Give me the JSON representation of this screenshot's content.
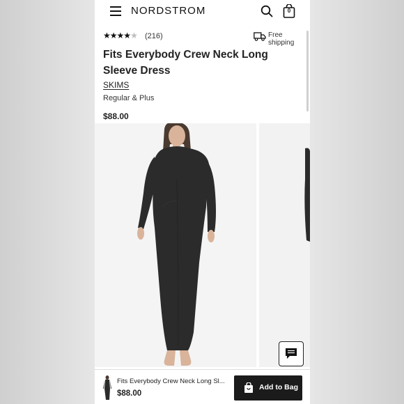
{
  "header": {
    "logo": "NORDSTROM",
    "bag_count": "0"
  },
  "product": {
    "rating": 4,
    "rating_max": 5,
    "review_count": "(216)",
    "shipping": "Free shipping",
    "title": "Fits Everybody Crew Neck Long Sleeve Dress",
    "brand": "SKIMS",
    "size_range": "Regular & Plus",
    "price": "$88.00"
  },
  "sticky_bar": {
    "name": "Fits Everybody Crew Neck Long Sl...",
    "price": "$88.00",
    "button_label": "Add to Bag"
  },
  "icons": [
    "menu-icon",
    "search-icon",
    "shopping-bag-icon",
    "star-icon",
    "truck-icon",
    "chat-icon"
  ],
  "colors": {
    "text": "#222222",
    "button": "#1b1b1b",
    "dress": "#2b2b2b"
  }
}
